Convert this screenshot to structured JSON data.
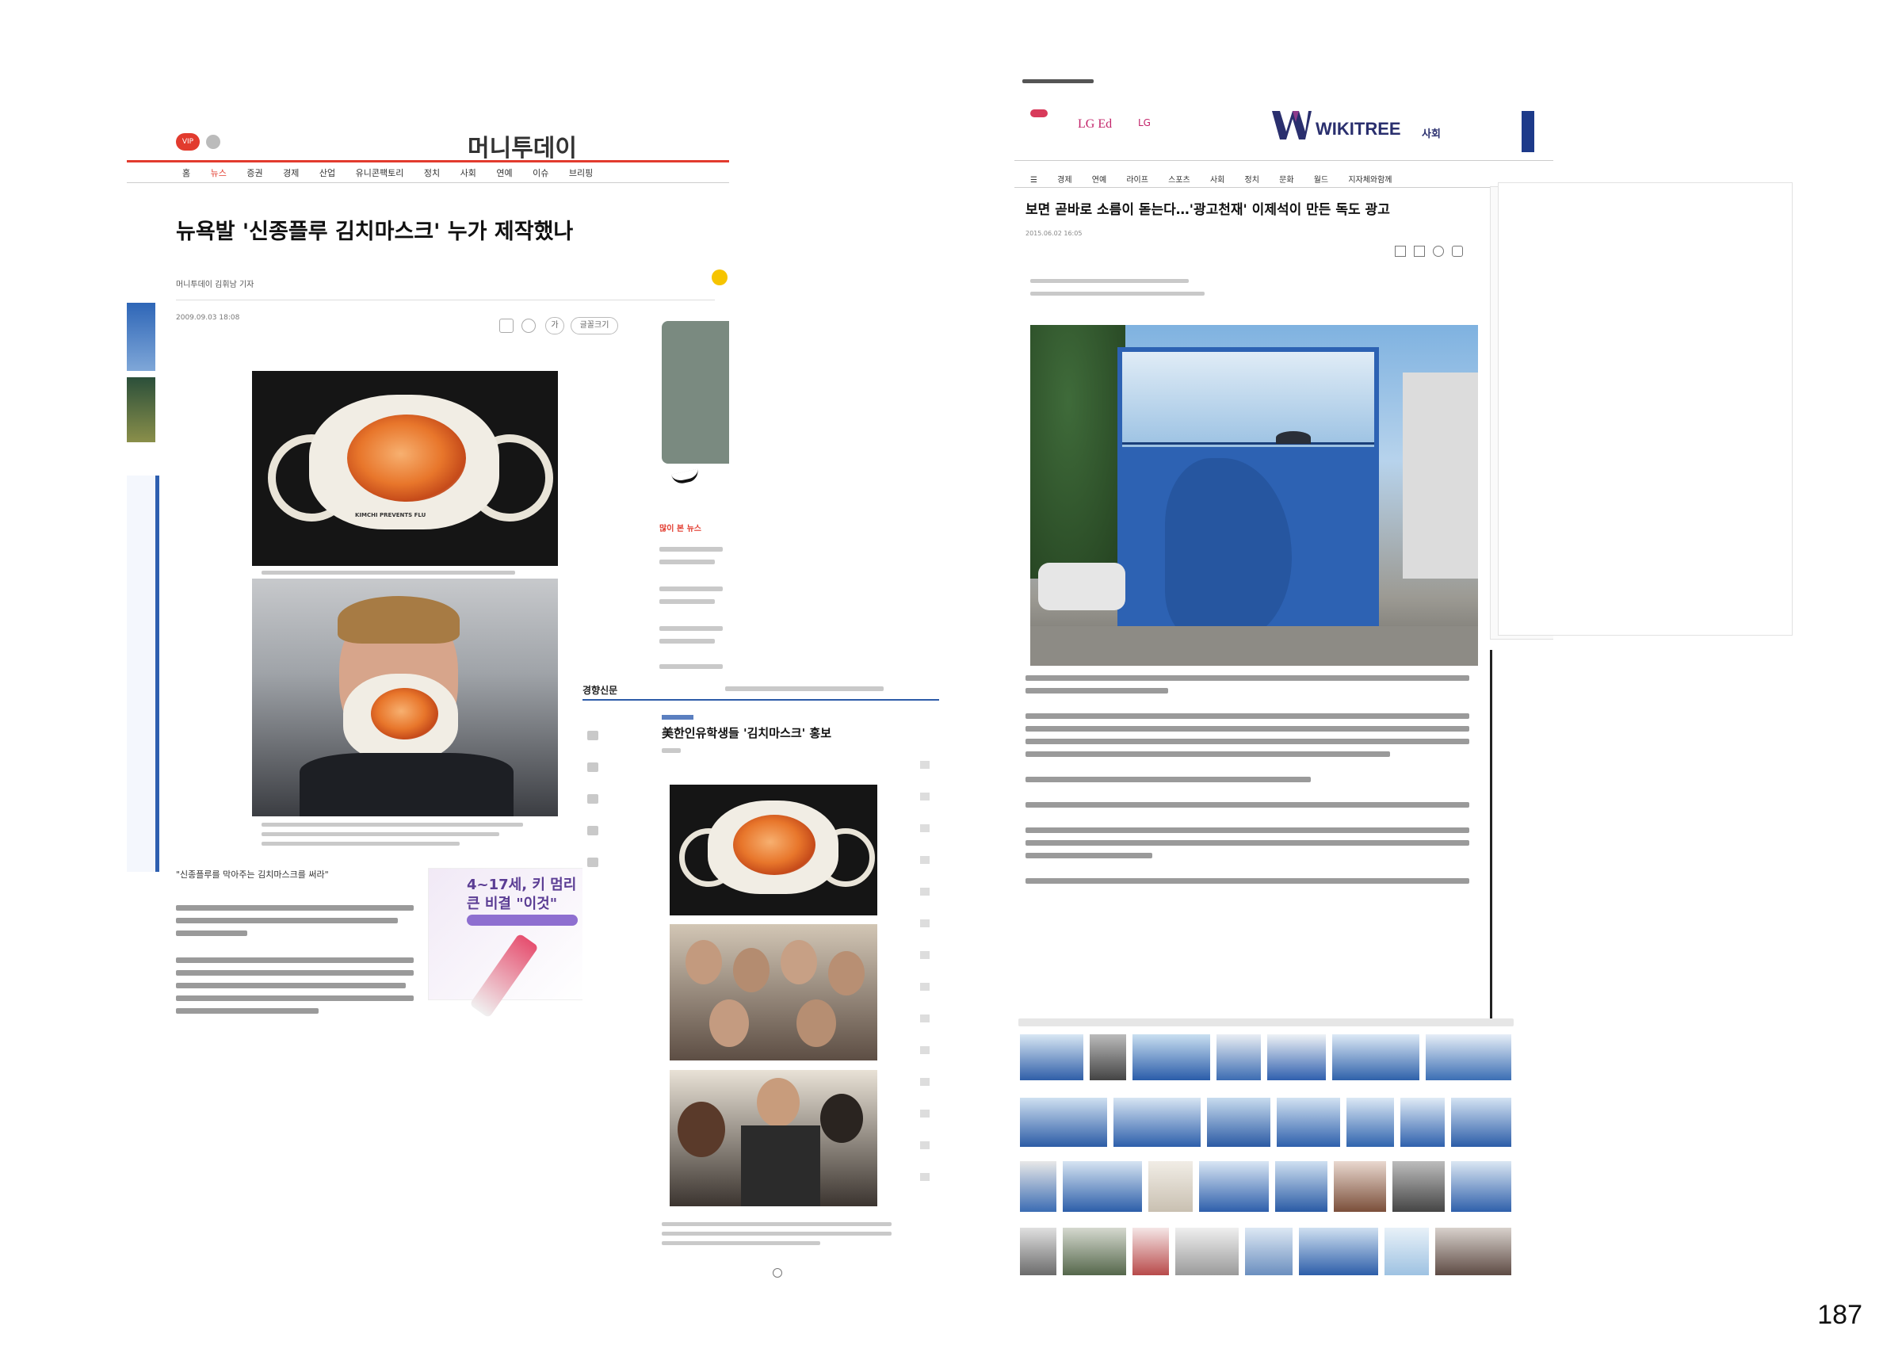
{
  "page_number": "187",
  "mt": {
    "brand": "머니투데이",
    "vip": "VIP",
    "nav": [
      "홈",
      "뉴스",
      "증권",
      "경제",
      "산업",
      "유니콘팩토리",
      "정치",
      "사회",
      "연예",
      "이슈",
      "브리핑"
    ],
    "headline": "뉴욕발 '신종플루 김치마스크' 누가 제작했나",
    "byline": "머니투데이 김휘남 기자",
    "date": "2009.09.03 18:08",
    "font_btn": "가",
    "share_btn": "글꼴크기",
    "mask_text": "KIMCHI PREVENTS FLU",
    "subhead": "\"신종플루를 막아주는 김치마스크를 써라\"",
    "ad_text1": "4~17세, 키 멈리",
    "ad_text2": "큰 비결 \"이것\"",
    "side_title": "많이 본 뉴스"
  },
  "kh": {
    "brand": "경향신문",
    "headline": "美한인유학생들 '김치마스크' 홍보"
  },
  "wt": {
    "ad_text": "LG Ed",
    "lg": "LG",
    "brand": "WIKITREE",
    "section": "사회",
    "nav": [
      "경제",
      "연예",
      "라이프",
      "스포츠",
      "사회",
      "정치",
      "문화",
      "월드",
      "지자체와함께"
    ],
    "headline": "보면 곧바로 소름이 돋는다…'광고천재' 이제석이 만든 독도 광고",
    "date": "2015.06.02 16:05"
  }
}
